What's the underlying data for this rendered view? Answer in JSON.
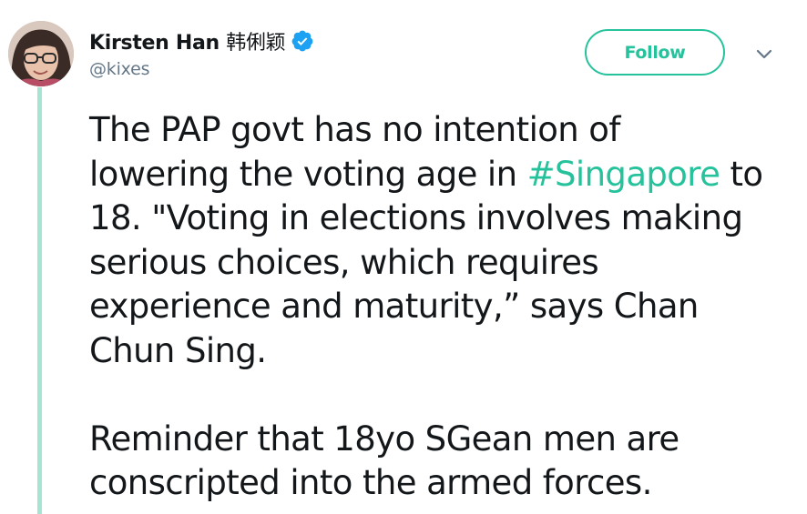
{
  "author": {
    "display_name": "Kirsten Han",
    "display_name_cjk": "韩俐颖",
    "handle": "@kixes",
    "verified": true,
    "verified_icon": "verified-badge-icon"
  },
  "follow_button": {
    "label": "Follow"
  },
  "menu": {
    "icon": "chevron-down-icon"
  },
  "tweet": {
    "paragraph1_pre": "The PAP govt has no intention of\nlowering the voting age in ",
    "hashtag": "#Singapore",
    "paragraph1_post": " to\n18. \"Voting in elections involves making\nserious choices, which requires\nexperience and maturity,” says Chan\nChun Sing.",
    "paragraph2": "Reminder that 18yo SGean men are\nconscripted into the armed forces."
  },
  "colors": {
    "accent": "#26c29c",
    "thread_line": "#a6e5d4",
    "verified_blue": "#1da1f2",
    "text": "#14171a",
    "secondary_text": "#657786"
  }
}
